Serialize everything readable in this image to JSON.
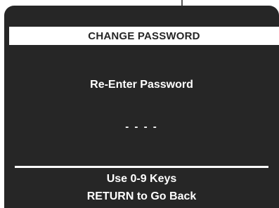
{
  "screen": {
    "title": "CHANGE PASSWORD",
    "prompt": "Re-Enter Password",
    "entry_mask": "- - - -",
    "hints": {
      "keys": "Use 0-9 Keys",
      "back": "RETURN to Go Back"
    }
  },
  "colors": {
    "background": "#262626",
    "foreground": "#ffffff"
  }
}
